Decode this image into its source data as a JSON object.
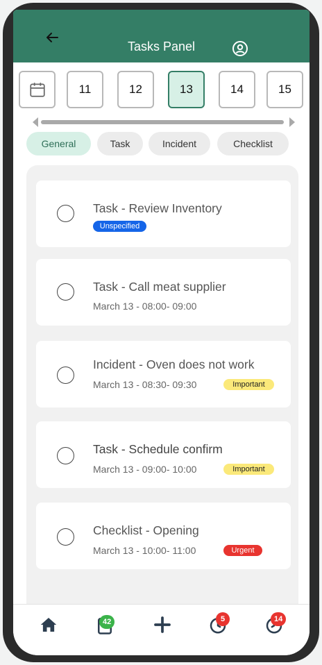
{
  "header": {
    "title": "Tasks Panel",
    "back_icon": "arrow-left-icon",
    "profile_icon": "user-circle-icon"
  },
  "dates": {
    "calendar_icon": "calendar-icon",
    "days": [
      "11",
      "12",
      "13",
      "14",
      "15"
    ],
    "selected": "13"
  },
  "filters": {
    "chips": [
      "General",
      "Task",
      "Incident",
      "Checklist"
    ],
    "active": "General"
  },
  "tasks": [
    {
      "title": "Task - Review Inventory",
      "subtitle": "",
      "badge": "Unspecified",
      "badge_color": "#1565e8"
    },
    {
      "title": "Task - Call meat supplier",
      "subtitle": "March 13 - 08:00- 09:00",
      "badge": "",
      "badge_color": ""
    },
    {
      "title": "Incident - Oven does not work",
      "subtitle": "March 13 - 08:30- 09:30",
      "badge": "Important",
      "badge_color": "#fbe97a"
    },
    {
      "title": "Task - Schedule confirm",
      "subtitle": "March 13 - 09:00- 10:00",
      "badge": "Important",
      "badge_color": "#fbe97a"
    },
    {
      "title": "Checklist - Opening",
      "subtitle": "March 13 - 10:00- 11:00",
      "badge": "Urgent",
      "badge_color": "#e8342f"
    }
  ],
  "nav": {
    "items": [
      {
        "icon": "home-icon",
        "badge": ""
      },
      {
        "icon": "clipboard-icon",
        "badge": "42",
        "badge_color": "#3bb34a"
      },
      {
        "icon": "plus-icon",
        "badge": ""
      },
      {
        "icon": "clock-icon",
        "badge": "5",
        "badge_color": "#e8342f"
      },
      {
        "icon": "history-icon",
        "badge": "14",
        "badge_color": "#e8342f"
      }
    ]
  },
  "colors": {
    "brand": "#347e66",
    "active_bg": "#d7f0e6"
  }
}
